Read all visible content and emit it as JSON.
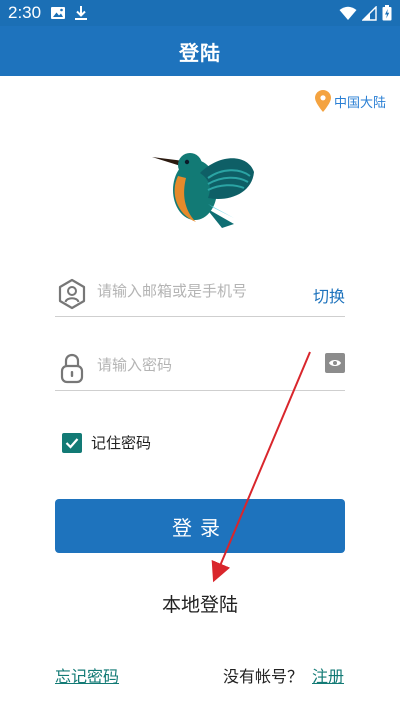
{
  "status_bar": {
    "time": "2:30",
    "left_icons": [
      "image-icon",
      "download-icon"
    ],
    "right_icons": [
      "wifi-icon",
      "signal-icon",
      "battery-icon"
    ]
  },
  "app_bar": {
    "title": "登陆"
  },
  "region": {
    "label": "中国大陆",
    "icon": "location-pin-icon"
  },
  "form": {
    "account": {
      "placeholder": "请输入邮箱或是手机号",
      "value": "",
      "icon": "user-shield-icon",
      "switch_label": "切换"
    },
    "password": {
      "placeholder": "请输入密码",
      "value": "",
      "icon": "lock-icon",
      "toggle_icon": "eye-icon"
    },
    "remember": {
      "label": "记住密码",
      "checked": true
    }
  },
  "actions": {
    "login_label": "登录",
    "local_login_label": "本地登陆",
    "forgot_label": "忘记密码",
    "no_account_label": "没有帐号？",
    "register_label": "注册"
  },
  "colors": {
    "primary": "#1e73bd",
    "accent_teal": "#127a75",
    "region_orange": "#f4a340",
    "annotation_red": "#d9262c"
  }
}
